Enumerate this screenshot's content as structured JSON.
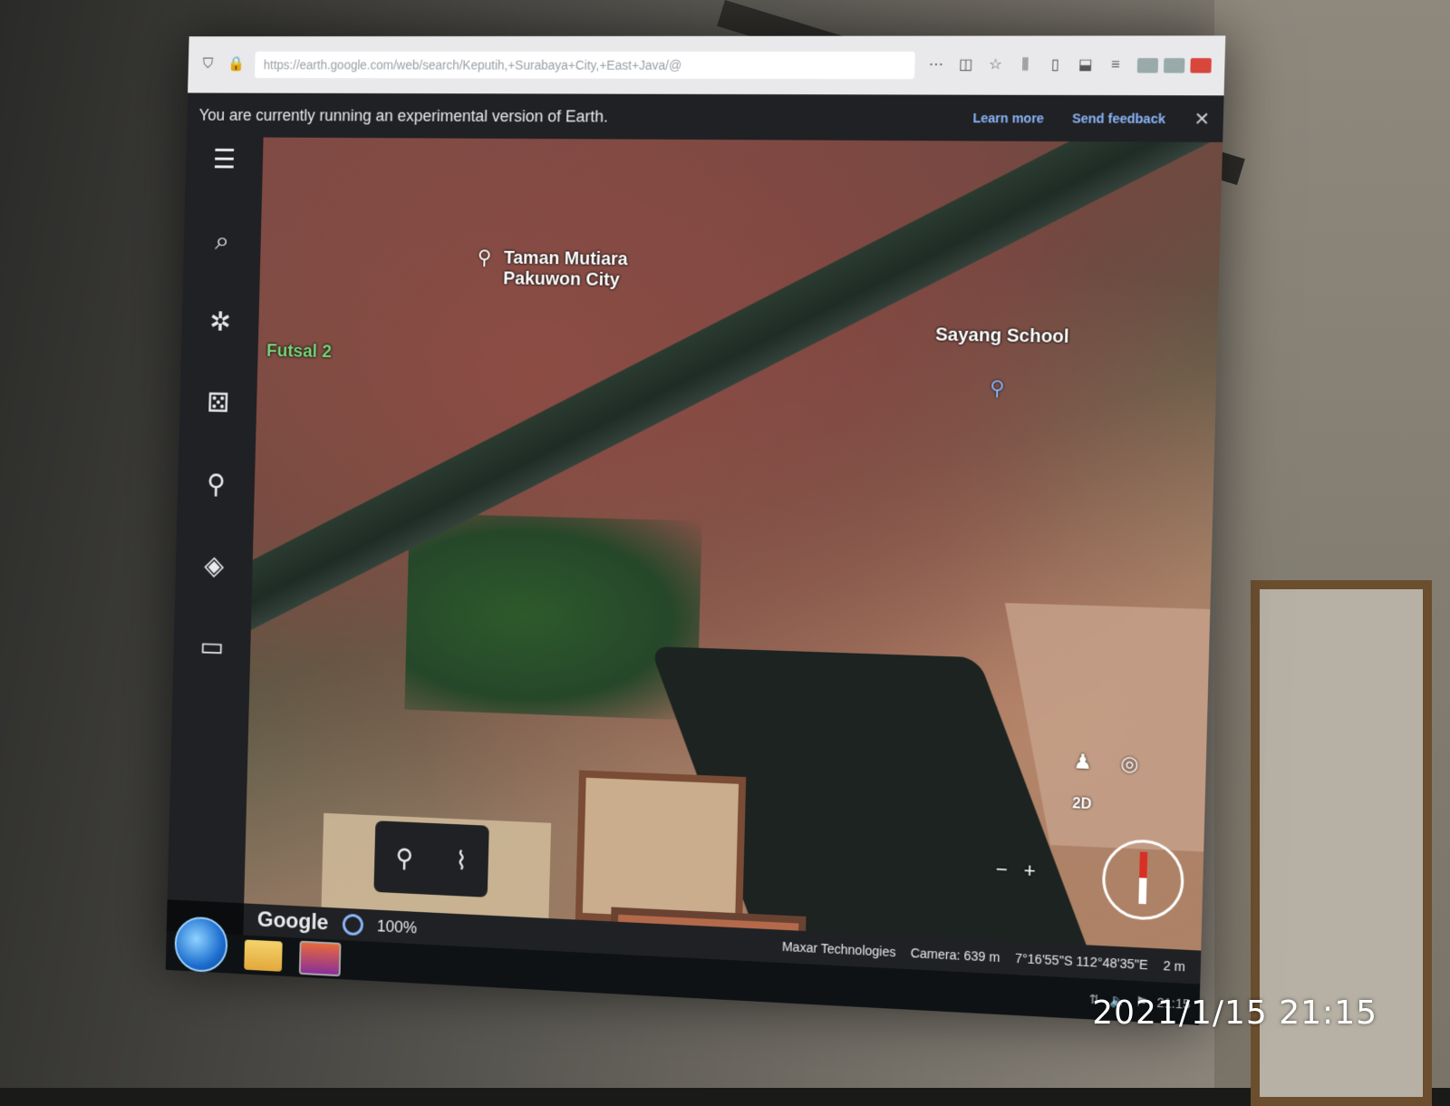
{
  "browser": {
    "url": "https://earth.google.com/web/search/Keputih,+Surabaya+City,+East+Java/@"
  },
  "banner": {
    "message": "You are currently running an experimental version of Earth.",
    "learn_more": "Learn more",
    "send_feedback": "Send feedback",
    "close": "✕"
  },
  "sidebar": {
    "items": [
      {
        "name": "menu-icon",
        "glyph": "☰"
      },
      {
        "name": "search-icon",
        "glyph": "⌕"
      },
      {
        "name": "voyager-icon",
        "glyph": "✲"
      },
      {
        "name": "feeling-lucky-icon",
        "glyph": "⚄"
      },
      {
        "name": "projects-icon",
        "glyph": "⚲"
      },
      {
        "name": "map-style-icon",
        "glyph": "◈"
      },
      {
        "name": "measure-icon",
        "glyph": "▭"
      }
    ]
  },
  "map": {
    "labels": {
      "taman_line1": "Taman Mutiara",
      "taman_line2": "Pakuwon City",
      "futsal": "Futsal 2",
      "school": "Sayang School"
    }
  },
  "tools": {
    "placemark_glyph": "⚲",
    "path_glyph": "⌇"
  },
  "nav": {
    "pegman": "♟",
    "my_location": "◎",
    "mode_2d": "2D",
    "zoom_out": "−",
    "zoom_in": "+"
  },
  "status": {
    "logo": "Google",
    "stream_percent": "100%",
    "attribution": "Maxar Technologies",
    "camera": "Camera: 639 m",
    "coordinates": "7°16'55\"S 112°48'35\"E",
    "scale": "2 m"
  },
  "taskbar": {
    "clock": "21:15"
  },
  "photo": {
    "timestamp": "2021/1/15  21:15"
  }
}
